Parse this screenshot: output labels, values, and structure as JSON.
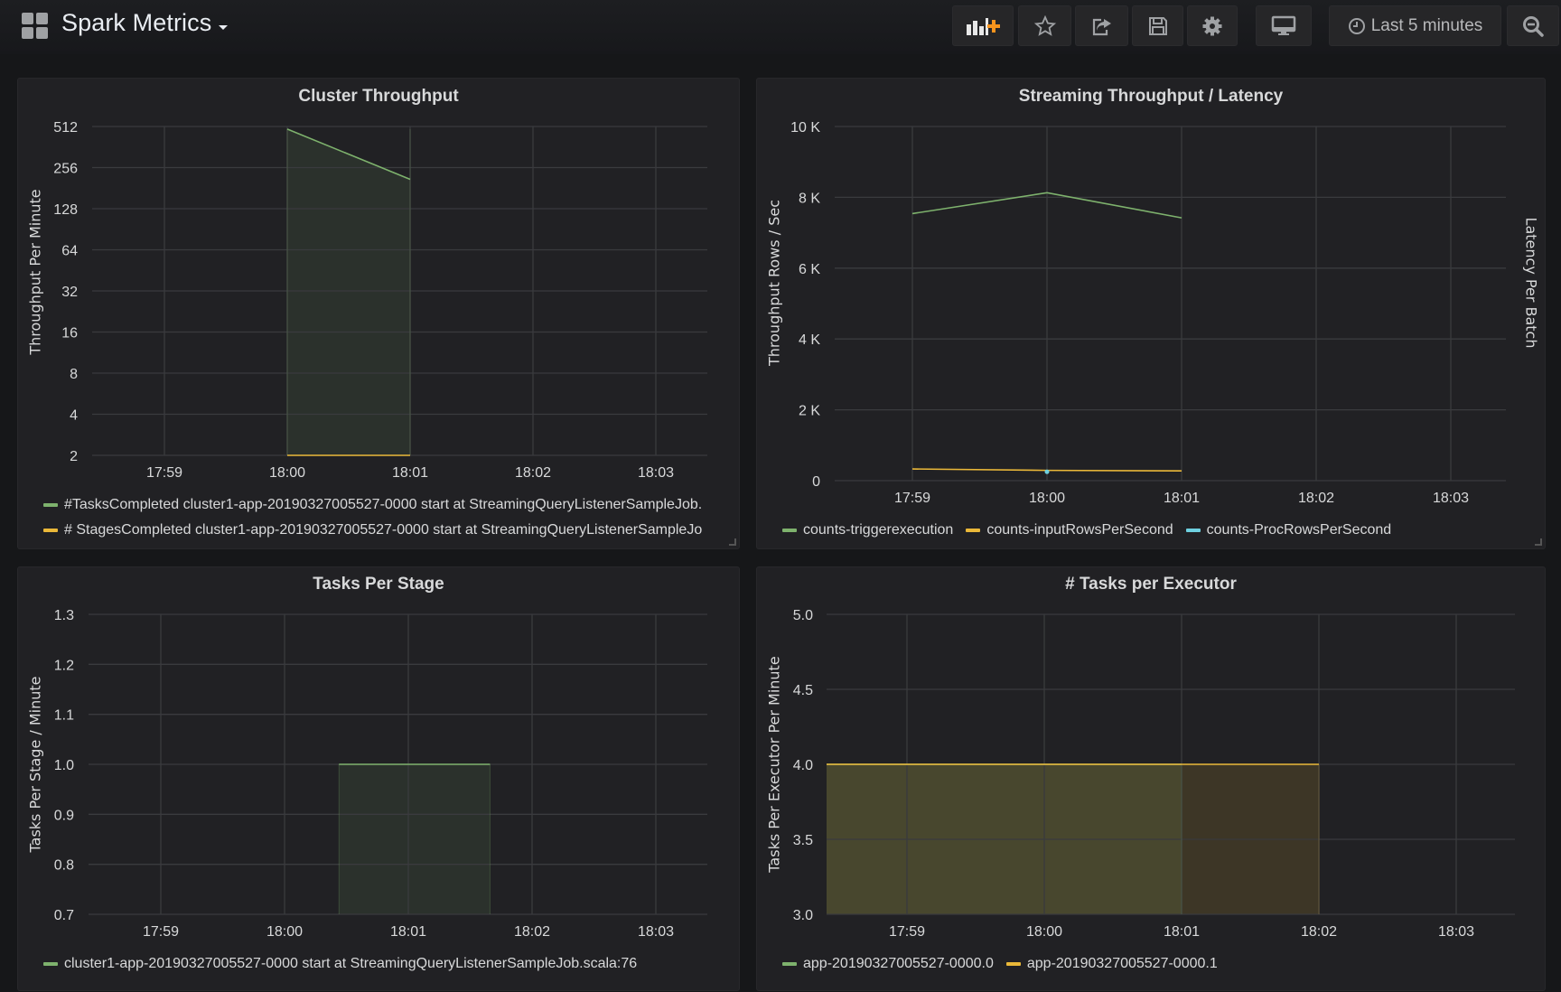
{
  "header": {
    "title": "Spark Metrics",
    "buttons": {
      "add_panel": "add-panel-icon",
      "star": "star-icon",
      "share": "share-icon",
      "save": "save-icon",
      "settings": "gear-icon",
      "tv_mode": "monitor-icon",
      "zoom_out": "zoom-out-icon"
    },
    "time_picker": "Last 5 minutes"
  },
  "colors": {
    "green": "#7eb26d",
    "yellow": "#eab839",
    "cyan": "#6ed0e0",
    "accent_orange": "#f7941d"
  },
  "chart_data": [
    {
      "id": "cluster-throughput",
      "type": "area",
      "title": "Cluster Throughput",
      "ylabel": "Throughput Per Minute",
      "yscale": "log2",
      "ylim": [
        2,
        512
      ],
      "yticks": [
        "512",
        "256",
        "128",
        "64",
        "32",
        "16",
        "8",
        "4",
        "2"
      ],
      "ytick_values": [
        512,
        256,
        128,
        64,
        32,
        16,
        8,
        4,
        2
      ],
      "x_ticks": [
        "17:59",
        "18:00",
        "18:01",
        "18:02",
        "18:03"
      ],
      "x_range_minutes": [
        -0.59,
        4.43
      ],
      "series": [
        {
          "name": "#TasksCompleted cluster1-app-20190327005527-0000 start at StreamingQueryListenerSampleJob.",
          "color": "#7eb26d",
          "fill": true,
          "x": [
            1,
            2
          ],
          "y": [
            490,
            210
          ]
        },
        {
          "name": "# StagesCompleted cluster1-app-20190327005527-0000 start at StreamingQueryListenerSampleJo",
          "color": "#eab839",
          "fill": false,
          "x": [
            1,
            2
          ],
          "y": [
            2,
            2
          ]
        }
      ]
    },
    {
      "id": "streaming-throughput",
      "type": "line",
      "title": "Streaming Throughput / Latency",
      "ylabel": "Throughput Rows / Sec",
      "ylabel_right": "Latency Per Batch",
      "ylim": [
        0,
        10000
      ],
      "yticks": [
        "10 K",
        "8 K",
        "6 K",
        "4 K",
        "2 K",
        "0"
      ],
      "ytick_values": [
        10000,
        8000,
        6000,
        4000,
        2000,
        0
      ],
      "x_ticks": [
        "17:59",
        "18:00",
        "18:01",
        "18:02",
        "18:03"
      ],
      "x_range_minutes": [
        -0.58,
        4.41
      ],
      "series": [
        {
          "name": "counts-triggerexecution",
          "color": "#7eb26d",
          "x": [
            0,
            1,
            2
          ],
          "y": [
            7540,
            8130,
            7420
          ]
        },
        {
          "name": "counts-inputRowsPerSecond",
          "color": "#eab839",
          "x": [
            0,
            1,
            2
          ],
          "y": [
            330,
            290,
            275
          ]
        },
        {
          "name": "counts-ProcRowsPerSecond",
          "color": "#6ed0e0",
          "x": [
            1
          ],
          "y": [
            250
          ]
        }
      ]
    },
    {
      "id": "tasks-per-stage",
      "type": "area",
      "title": "Tasks Per Stage",
      "ylabel": "Tasks Per Stage / Minute",
      "ylim": [
        0.7,
        1.3
      ],
      "yticks": [
        "1.3",
        "1.2",
        "1.1",
        "1.0",
        "0.9",
        "0.8",
        "0.7"
      ],
      "ytick_values": [
        1.3,
        1.2,
        1.1,
        1.0,
        0.9,
        0.8,
        0.7
      ],
      "x_ticks": [
        "17:59",
        "18:00",
        "18:01",
        "18:02",
        "18:03"
      ],
      "x_range_minutes": [
        -0.58,
        4.42
      ],
      "series": [
        {
          "name": "cluster1-app-20190327005527-0000 start at StreamingQueryListenerSampleJob.scala:76",
          "color": "#7eb26d",
          "fill": true,
          "x": [
            1.44,
            2.66
          ],
          "y": [
            1.0,
            1.0
          ]
        }
      ]
    },
    {
      "id": "tasks-per-executor",
      "type": "area",
      "title": "# Tasks per Executor",
      "ylabel": "Tasks Per Executor Per Minute",
      "ylim": [
        3.0,
        5.0
      ],
      "yticks": [
        "5.0",
        "4.5",
        "4.0",
        "3.5",
        "3.0"
      ],
      "ytick_values": [
        5.0,
        4.5,
        4.0,
        3.5,
        3.0
      ],
      "x_ticks": [
        "17:59",
        "18:00",
        "18:01",
        "18:02",
        "18:03"
      ],
      "x_range_minutes": [
        -0.59,
        4.42
      ],
      "series": [
        {
          "name": "app-20190327005527-0000.0",
          "color": "#7eb26d",
          "fill": true,
          "x": [
            -0.59,
            2
          ],
          "y": [
            4.0,
            4.0
          ]
        },
        {
          "name": "app-20190327005527-0000.1",
          "color": "#eab839",
          "fill": true,
          "x": [
            -0.59,
            3
          ],
          "y": [
            4.0,
            4.0
          ]
        }
      ]
    }
  ]
}
